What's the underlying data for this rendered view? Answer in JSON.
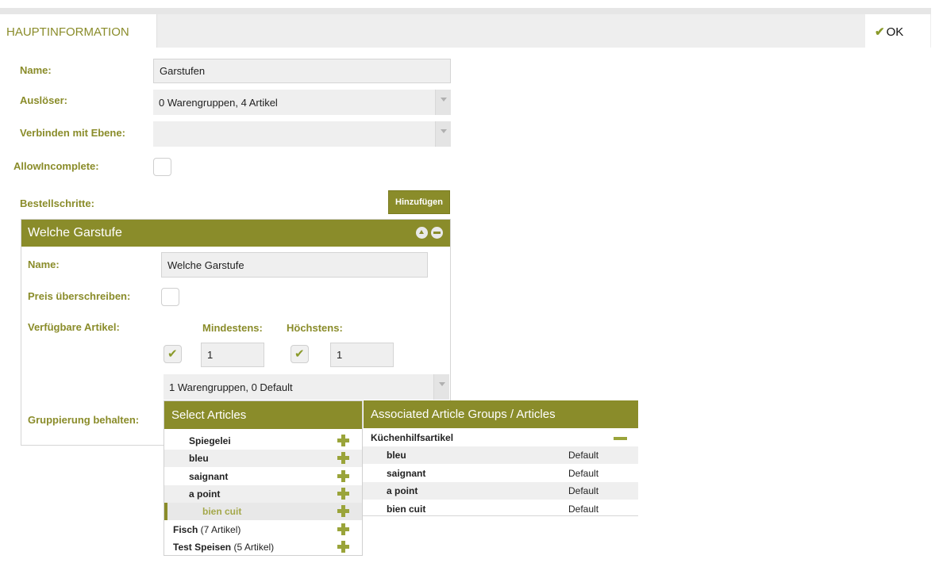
{
  "header": {
    "tab_label": "HAUPTINFORMATION",
    "ok_label": "OK"
  },
  "form": {
    "name_label": "Name:",
    "name_value": "Garstufen",
    "trigger_label": "Auslöser:",
    "trigger_value": "0 Warengruppen, 4 Artikel",
    "link_label": "Verbinden mit Ebene:",
    "link_value": "",
    "allow_label": "AllowIncomplete:",
    "allow_checked": false,
    "steps_label": "Bestellschritte:",
    "add_label": "Hinzufügen"
  },
  "step": {
    "title": "Welche Garstufe",
    "name_label": "Name:",
    "name_value": "Welche Garstufe",
    "price_label": "Preis überschreiben:",
    "articles_label": "Verfügbare Artikel:",
    "min_label": "Mindestens:",
    "max_label": "Höchstens:",
    "min_checked": true,
    "min_value": "1",
    "max_checked": true,
    "max_value": "1",
    "groups_value": "1 Warengruppen, 0 Default",
    "grouping_label": "Gruppierung behalten:"
  },
  "select_articles": {
    "title": "Select Articles",
    "items": [
      {
        "name": "Spiegelei",
        "extra": ""
      },
      {
        "name": "bleu",
        "extra": ""
      },
      {
        "name": "saignant",
        "extra": ""
      },
      {
        "name": "a point",
        "extra": ""
      },
      {
        "name": "bien cuit",
        "extra": "",
        "selected": true
      },
      {
        "name": "Fisch",
        "extra": " (7 Artikel)"
      },
      {
        "name": "Test Speisen",
        "extra": " (5 Artikel)"
      }
    ]
  },
  "associated": {
    "title": "Associated Article Groups / Articles",
    "group": "Küchenhilfsartikel",
    "items": [
      {
        "name": "bleu",
        "value": "Default"
      },
      {
        "name": "saignant",
        "value": "Default"
      },
      {
        "name": "a point",
        "value": "Default"
      },
      {
        "name": "bien cuit",
        "value": "Default"
      }
    ]
  },
  "colors": {
    "accent": "#8a8c2a",
    "label": "#8a8c2a",
    "plus": "#9aa43a"
  }
}
